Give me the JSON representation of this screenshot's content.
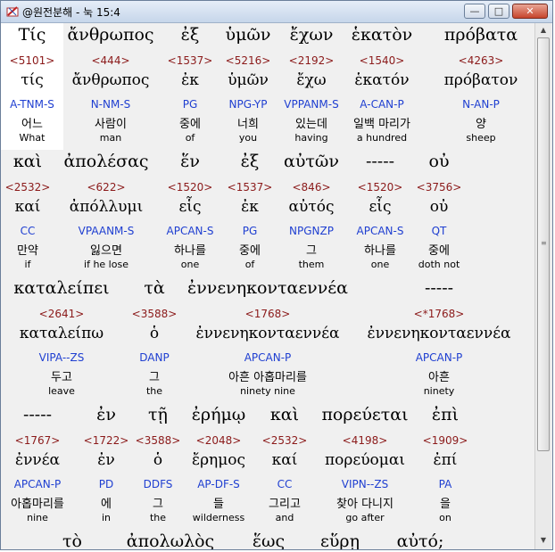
{
  "window": {
    "title": "@원전분해 - 눅 15:4",
    "minimize": "—",
    "maximize": "□",
    "close": "✕"
  },
  "rows": [
    {
      "words": [
        {
          "greek": "Τίς",
          "num": "<5101>",
          "lemma": "τίς",
          "parse": "A-TNM-S",
          "kor": "어느",
          "eng": "What"
        },
        {
          "greek": "ἄνθρωπος",
          "num": "<444>",
          "lemma": "ἄνθρωπος",
          "parse": "N-NM-S",
          "kor": "사람이",
          "eng": "man"
        },
        {
          "greek": "ἐξ",
          "num": "<1537>",
          "lemma": "ἐκ",
          "parse": "PG",
          "kor": "중에",
          "eng": "of"
        },
        {
          "greek": "ὑμῶν",
          "num": "<5216>",
          "lemma": "ὑμῶν",
          "parse": "NPG-YP",
          "kor": "너희",
          "eng": "you"
        },
        {
          "greek": "ἔχων",
          "num": "<2192>",
          "lemma": "ἔχω",
          "parse": "VPPANM-S",
          "kor": "있는데",
          "eng": "having"
        },
        {
          "greek": "ἑκατὸν",
          "num": "<1540>",
          "lemma": "ἑκατόν",
          "parse": "A-CAN-P",
          "kor": "일백 마리가",
          "eng": "a hundred"
        },
        {
          "greek": "πρόβατα",
          "num": "<4263>",
          "lemma": "πρόβατον",
          "parse": "N-AN-P",
          "kor": "양",
          "eng": "sheep"
        }
      ]
    },
    {
      "words": [
        {
          "greek": "καὶ",
          "num": "<2532>",
          "lemma": "καί",
          "parse": "CC",
          "kor": "만약",
          "eng": "if"
        },
        {
          "greek": "ἀπολέσας",
          "num": "<622>",
          "lemma": "ἀπόλλυμι",
          "parse": "VPAANM-S",
          "kor": "잃으면",
          "eng": "if he lose"
        },
        {
          "greek": "ἕν",
          "num": "<1520>",
          "lemma": "εἷς",
          "parse": "APCAN-S",
          "kor": "하나를",
          "eng": "one"
        },
        {
          "greek": "ἐξ",
          "num": "<1537>",
          "lemma": "ἐκ",
          "parse": "PG",
          "kor": "중에",
          "eng": "of"
        },
        {
          "greek": "αὐτῶν",
          "num": "<846>",
          "lemma": "αὐτός",
          "parse": "NPGNZP",
          "kor": "그",
          "eng": "them"
        },
        {
          "greek": "-----",
          "num": "<1520>",
          "lemma": "εἷς",
          "parse": "APCAN-S",
          "kor": "하나를",
          "eng": "one"
        },
        {
          "greek": "οὐ",
          "num": "<3756>",
          "lemma": "οὐ",
          "parse": "QT",
          "kor": "중에",
          "eng": "doth not"
        }
      ]
    },
    {
      "words": [
        {
          "greek": "καταλείπει",
          "num": "<2641>",
          "lemma": "καταλείπω",
          "parse": "VIPA--ZS",
          "kor": "두고",
          "eng": "leave"
        },
        {
          "greek": "τὰ",
          "num": "<3588>",
          "lemma": "ὁ",
          "parse": "DANP",
          "kor": "그",
          "eng": "the"
        },
        {
          "greek": "ἐννενηκονταεννέα",
          "num": "<1768>",
          "lemma": "ἐννενηκονταεννέα",
          "parse": "APCAN-P",
          "kor": "아흔 아홉마리를",
          "eng": "ninety nine"
        },
        {
          "greek": "-----",
          "num": "<*1768>",
          "lemma": "ἐννενηκονταεννέα",
          "parse": "APCAN-P",
          "kor": "아흔",
          "eng": "ninety"
        }
      ]
    },
    {
      "words": [
        {
          "greek": "-----",
          "num": "<1767>",
          "lemma": "ἐννέα",
          "parse": "APCAN-P",
          "kor": "아홉마리를",
          "eng": "nine"
        },
        {
          "greek": "ἐν",
          "num": "<1722>",
          "lemma": "ἐν",
          "parse": "PD",
          "kor": "에",
          "eng": "in"
        },
        {
          "greek": "τῇ",
          "num": "<3588>",
          "lemma": "ὁ",
          "parse": "DDFS",
          "kor": "그",
          "eng": "the"
        },
        {
          "greek": "ἐρήμῳ",
          "num": "<2048>",
          "lemma": "ἔρημος",
          "parse": "AP-DF-S",
          "kor": "들",
          "eng": "wilderness"
        },
        {
          "greek": "καὶ",
          "num": "<2532>",
          "lemma": "καί",
          "parse": "CC",
          "kor": "그리고",
          "eng": "and"
        },
        {
          "greek": "πορεύεται",
          "num": "<4198>",
          "lemma": "πορεύομαι",
          "parse": "VIPN--ZS",
          "kor": "찾아 다니지",
          "eng": "go after"
        },
        {
          "greek": "ἐπὶ",
          "num": "<1909>",
          "lemma": "ἐπί",
          "parse": "PA",
          "kor": "을",
          "eng": "on"
        }
      ]
    },
    {
      "words": [
        {
          "greek": "τὸ"
        },
        {
          "greek": "ἀπολωλὸς"
        },
        {
          "greek": "ἕως"
        },
        {
          "greek": "εὕρῃ"
        },
        {
          "greek": "αὐτό;"
        }
      ]
    }
  ]
}
